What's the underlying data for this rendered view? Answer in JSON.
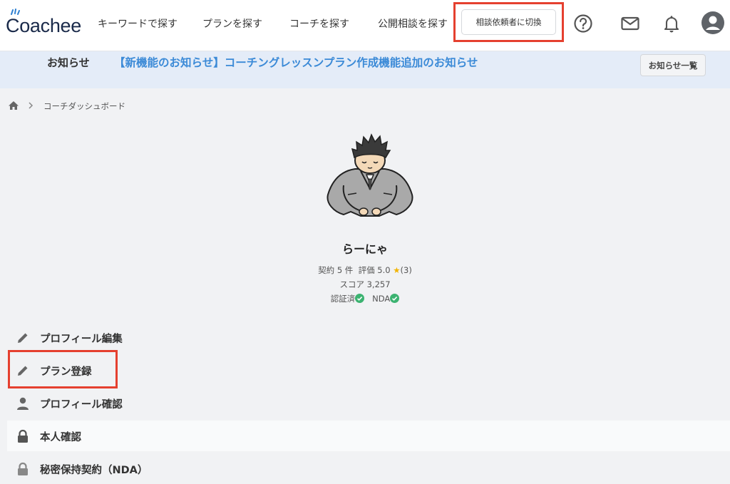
{
  "header": {
    "logo_text": "Coachee",
    "nav": [
      {
        "label": "キーワードで探す"
      },
      {
        "label": "プランを探す"
      },
      {
        "label": "コーチを探す"
      },
      {
        "label": "公開相談を探す"
      }
    ],
    "switch_label": "相談依頼者に切換",
    "icons": [
      "help-icon",
      "mail-icon",
      "bell-icon",
      "user-account-icon"
    ]
  },
  "notice": {
    "label": "お知らせ",
    "text": "【新機能のお知らせ】コーチングレッスンプラン作成機能追加のお知らせ",
    "list_button": "お知らせ一覧"
  },
  "breadcrumb": {
    "current": "コーチダッシュボード"
  },
  "profile": {
    "name": "らーにゃ",
    "contracts_label": "契約",
    "contracts_value": "5",
    "contracts_unit": "件",
    "rating_label": "評価",
    "rating_value": "5.0",
    "rating_count": "(3)",
    "score_label": "スコア",
    "score_value": "3,257",
    "verified_label": "認証済",
    "nda_label": "NDA"
  },
  "menu": [
    {
      "label": "プロフィール編集",
      "icon": "pencil-icon"
    },
    {
      "label": "プラン登録",
      "icon": "pencil-icon"
    },
    {
      "label": "プロフィール確認",
      "icon": "person-icon"
    },
    {
      "label": "本人確認",
      "icon": "lock-icon"
    },
    {
      "label": "秘密保持契約（NDA）",
      "icon": "lock-icon"
    }
  ],
  "colors": {
    "accent_blue": "#3b8ad7",
    "highlight_red": "#e5402f",
    "notice_bg": "#e4ecf8",
    "check_green": "#3cb371",
    "star_yellow": "#f2b400"
  }
}
